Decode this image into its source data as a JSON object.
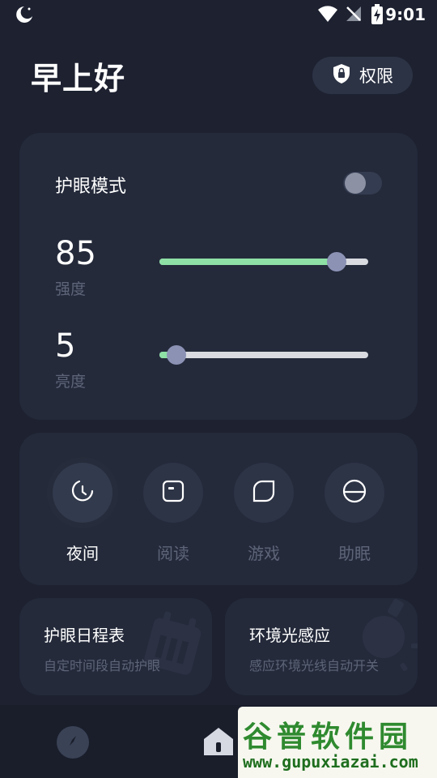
{
  "status_bar": {
    "time": "9:01"
  },
  "header": {
    "greeting": "早上好",
    "permission_label": "权限"
  },
  "eye_mode": {
    "title": "护眼模式",
    "enabled": false,
    "intensity": {
      "value": "85",
      "label": "强度",
      "percent": 85
    },
    "brightness": {
      "value": "5",
      "label": "亮度",
      "percent": 5
    }
  },
  "modes": [
    {
      "label": "夜间",
      "active": true,
      "icon": "moon-clock-icon"
    },
    {
      "label": "阅读",
      "active": false,
      "icon": "book-icon"
    },
    {
      "label": "游戏",
      "active": false,
      "icon": "leaf-icon"
    },
    {
      "label": "助眠",
      "active": false,
      "icon": "sleep-icon"
    }
  ],
  "schedule_card": {
    "title": "护眼日程表",
    "desc": "自定时间段自动护眼"
  },
  "ambient_card": {
    "title": "环境光感应",
    "desc": "感应环境光线自动开关"
  },
  "watermark": {
    "title": "谷普软件园",
    "url": "www.gupuxiazai.com"
  },
  "colors": {
    "accent_green": "#8ee0a5",
    "thumb": "#8b92b4",
    "background": "#1d2130",
    "card": "#242a3a"
  }
}
